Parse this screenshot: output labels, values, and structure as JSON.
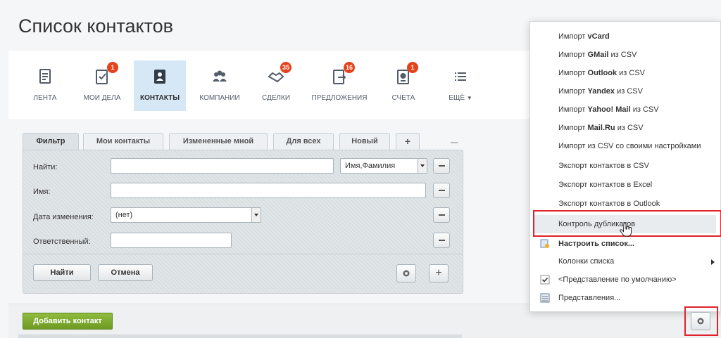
{
  "page": {
    "title": "Список контактов"
  },
  "nav": [
    {
      "label": "Лента",
      "icon": "feed-icon",
      "badge": ""
    },
    {
      "label": "Мои дела",
      "icon": "tasks-icon",
      "badge": "1"
    },
    {
      "label": "Контакты",
      "icon": "contacts-icon",
      "badge": ""
    },
    {
      "label": "Компании",
      "icon": "companies-icon",
      "badge": ""
    },
    {
      "label": "Сделки",
      "icon": "deals-icon",
      "badge": "35"
    },
    {
      "label": "Предложения",
      "icon": "quotes-icon",
      "badge": "16"
    },
    {
      "label": "Счета",
      "icon": "invoices-icon",
      "badge": "1"
    },
    {
      "label": "Ещё",
      "icon": "more-icon",
      "badge": ""
    }
  ],
  "filter": {
    "tabs": [
      "Фильтр",
      "Мои контакты",
      "Измененные мной",
      "Для всех",
      "Новый"
    ],
    "plus": "+",
    "fields": {
      "find_label": "Найти:",
      "find_value": "",
      "find_scope": "Имя,Фамилия",
      "name_label": "Имя:",
      "name_value": "",
      "date_label": "Дата изменения:",
      "date_value": "(нет)",
      "resp_label": "Ответственный:",
      "resp_value": ""
    },
    "find_button": "Найти",
    "cancel_button": "Отмена"
  },
  "list": {
    "add_button": "Добавить контакт"
  },
  "menu": {
    "items": [
      {
        "pre": "Импорт ",
        "bold": "vCard",
        "post": ""
      },
      {
        "pre": "Импорт ",
        "bold": "GMail",
        "post": " из CSV"
      },
      {
        "pre": "Импорт ",
        "bold": "Outlook",
        "post": " из CSV"
      },
      {
        "pre": "Импорт ",
        "bold": "Yandex",
        "post": " из CSV"
      },
      {
        "pre": "Импорт ",
        "bold": "Yahoo! Mail",
        "post": " из CSV"
      },
      {
        "pre": "Импорт ",
        "bold": "Mail.Ru",
        "post": " из CSV"
      },
      {
        "pre": "Импорт из CSV со своими настройками",
        "bold": "",
        "post": ""
      },
      {
        "pre": "Экспорт контактов в CSV",
        "bold": "",
        "post": ""
      },
      {
        "pre": "Экспорт контактов в Excel",
        "bold": "",
        "post": ""
      },
      {
        "pre": "Экспорт контактов в Outlook",
        "bold": "",
        "post": ""
      }
    ],
    "duplicates": "Контроль дубликатов",
    "configure": "Настроить список...",
    "columns": "Колонки списка",
    "default_view": "<Представление по умолчанию>",
    "views": "Представления..."
  }
}
